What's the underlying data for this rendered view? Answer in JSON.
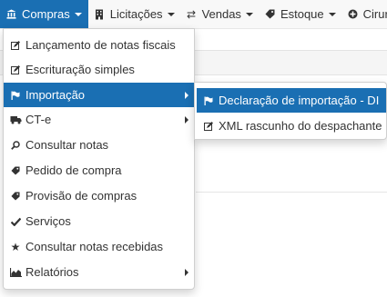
{
  "navbar": {
    "items": [
      {
        "label": "Compras",
        "icon": "bank-icon"
      },
      {
        "label": "Licitações",
        "icon": "building-icon"
      },
      {
        "label": "Vendas",
        "icon": "exchange-icon"
      },
      {
        "label": "Estoque",
        "icon": "tag-icon"
      },
      {
        "label": "Cirurgi",
        "icon": "plus-circle-icon"
      }
    ]
  },
  "compras_menu": {
    "items": [
      {
        "label": "Lançamento de notas fiscais",
        "icon": "edit-icon"
      },
      {
        "label": "Escrituração simples",
        "icon": "edit-icon"
      },
      {
        "label": "Importação",
        "icon": "flag-icon",
        "active": true,
        "has_submenu": true
      },
      {
        "label": "CT-e",
        "icon": "truck-icon",
        "has_submenu": true
      },
      {
        "label": "Consultar notas",
        "icon": "search-icon"
      },
      {
        "label": "Pedido de compra",
        "icon": "tag-icon"
      },
      {
        "label": "Provisão de compras",
        "icon": "tag-icon"
      },
      {
        "label": "Serviços",
        "icon": "check-icon"
      },
      {
        "label": "Consultar notas recebidas",
        "icon": "star-icon"
      },
      {
        "label": "Relatórios",
        "icon": "chart-icon",
        "has_submenu": true
      }
    ]
  },
  "importacao_submenu": {
    "items": [
      {
        "label": "Declaração de importação - DI",
        "icon": "flag-icon",
        "active": true
      },
      {
        "label": "XML rascunho do despachante",
        "icon": "edit-icon"
      }
    ]
  },
  "colors": {
    "accent": "#1a6fb3",
    "navbar_bg": "#f8f8f8"
  }
}
